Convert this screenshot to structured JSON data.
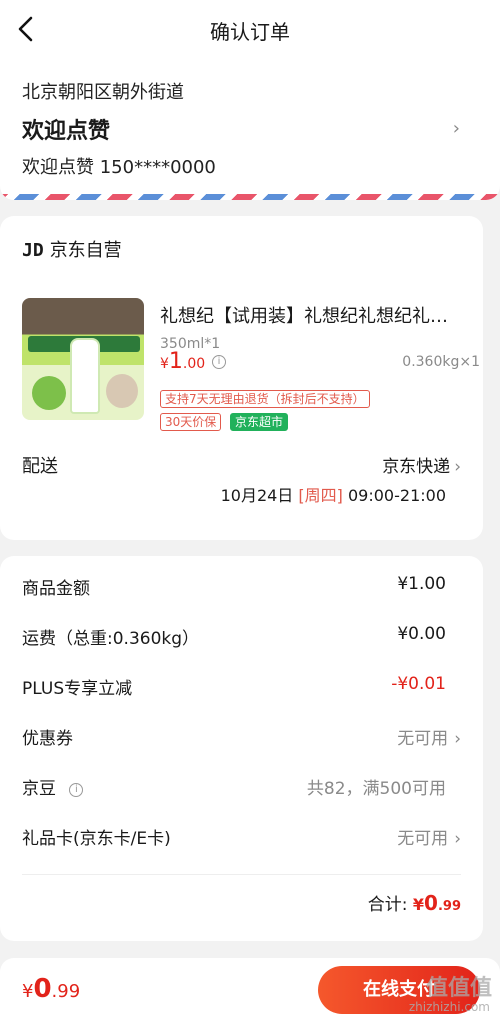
{
  "header": {
    "title": "确认订单"
  },
  "address": {
    "line": "北京朝阳区朝外街道",
    "name": "欢迎点赞",
    "contact": "欢迎点赞 150****0000",
    "chevron": "›"
  },
  "shop": {
    "logo": "JD",
    "name": "京东自营"
  },
  "product": {
    "name": "礼想纪【试用装】礼想纪礼想纪礼想纪礼想纪",
    "spec": "350ml*1",
    "price_symbol": "¥",
    "price_int": "1",
    "price_dec": ".00",
    "weight_qty": "0.360kg×1",
    "tags": [
      "支持7天无理由退货（拆封后不支持）",
      "30天价保",
      "京东超市"
    ]
  },
  "shipping": {
    "label": "配送",
    "carrier": "京东快递",
    "date": "10月24日",
    "weekday": "[周四]",
    "time": "09:00-21:00"
  },
  "summary": {
    "rows": [
      {
        "label": "商品金额",
        "value": "¥1.00"
      },
      {
        "label": "运费（总重:0.360kg）",
        "value": "¥0.00"
      },
      {
        "label": "PLUS专享立减",
        "value": "-¥0.01"
      },
      {
        "label": "优惠券",
        "value": "无可用"
      },
      {
        "label": "京豆",
        "value": "共82，满500可用"
      },
      {
        "label": "礼品卡(京东卡/E卡)",
        "value": "无可用"
      }
    ],
    "total_label": "合计:",
    "total_symbol": "¥",
    "total_int": "0",
    "total_dec": ".99"
  },
  "footer": {
    "symbol": "¥",
    "int": "0",
    "dec": ".99",
    "pay_label": "在线支付"
  },
  "watermark": {
    "main": "值值值",
    "sub": "zhizhizhi.com"
  },
  "colors": {
    "accent": "#e2231a",
    "green_tag": "#21b15b"
  }
}
